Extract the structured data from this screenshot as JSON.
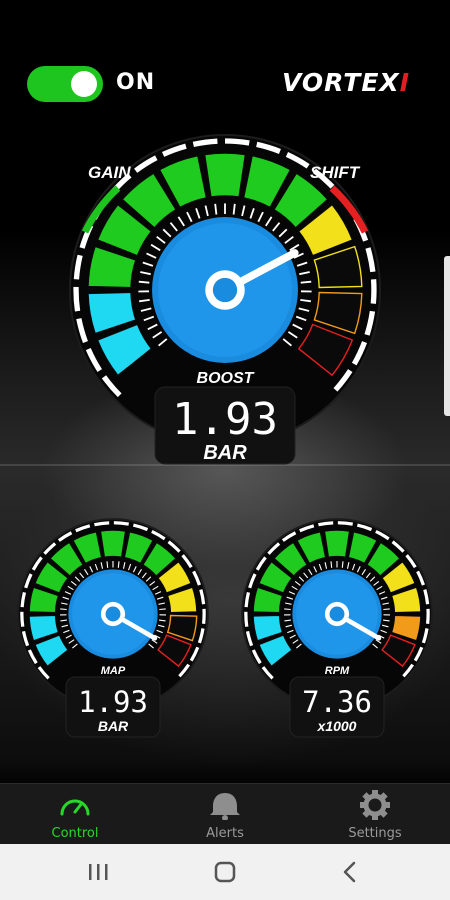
{
  "header": {
    "toggle_state": "ON",
    "brand_name": "VORTEX",
    "brand_accent": "I"
  },
  "gauges": {
    "boost": {
      "title": "BOOST",
      "value": "1.93",
      "unit": "BAR",
      "label_left": "GAIN",
      "label_right": "SHIFT"
    },
    "map": {
      "title": "MAP",
      "value": "1.93",
      "unit": "BAR"
    },
    "rpm": {
      "title": "RPM",
      "value": "7.36",
      "unit": "x1000"
    }
  },
  "tabs": [
    {
      "label": "Control",
      "icon": "speedometer-icon",
      "active": true
    },
    {
      "label": "Alerts",
      "icon": "bell-icon",
      "active": false
    },
    {
      "label": "Settings",
      "icon": "gear-icon",
      "active": false
    }
  ],
  "system_nav": {
    "recents_icon": "recents-icon",
    "home_icon": "home-icon",
    "back_icon": "back-icon"
  },
  "colors": {
    "accent_green": "#1ec51e",
    "tab_active": "#27d827",
    "zone_cyan": "#1fd8f2",
    "zone_green": "#1ecb1e",
    "zone_yellow": "#f2e01a",
    "zone_orange": "#f29a1a",
    "zone_red": "#e52020"
  }
}
